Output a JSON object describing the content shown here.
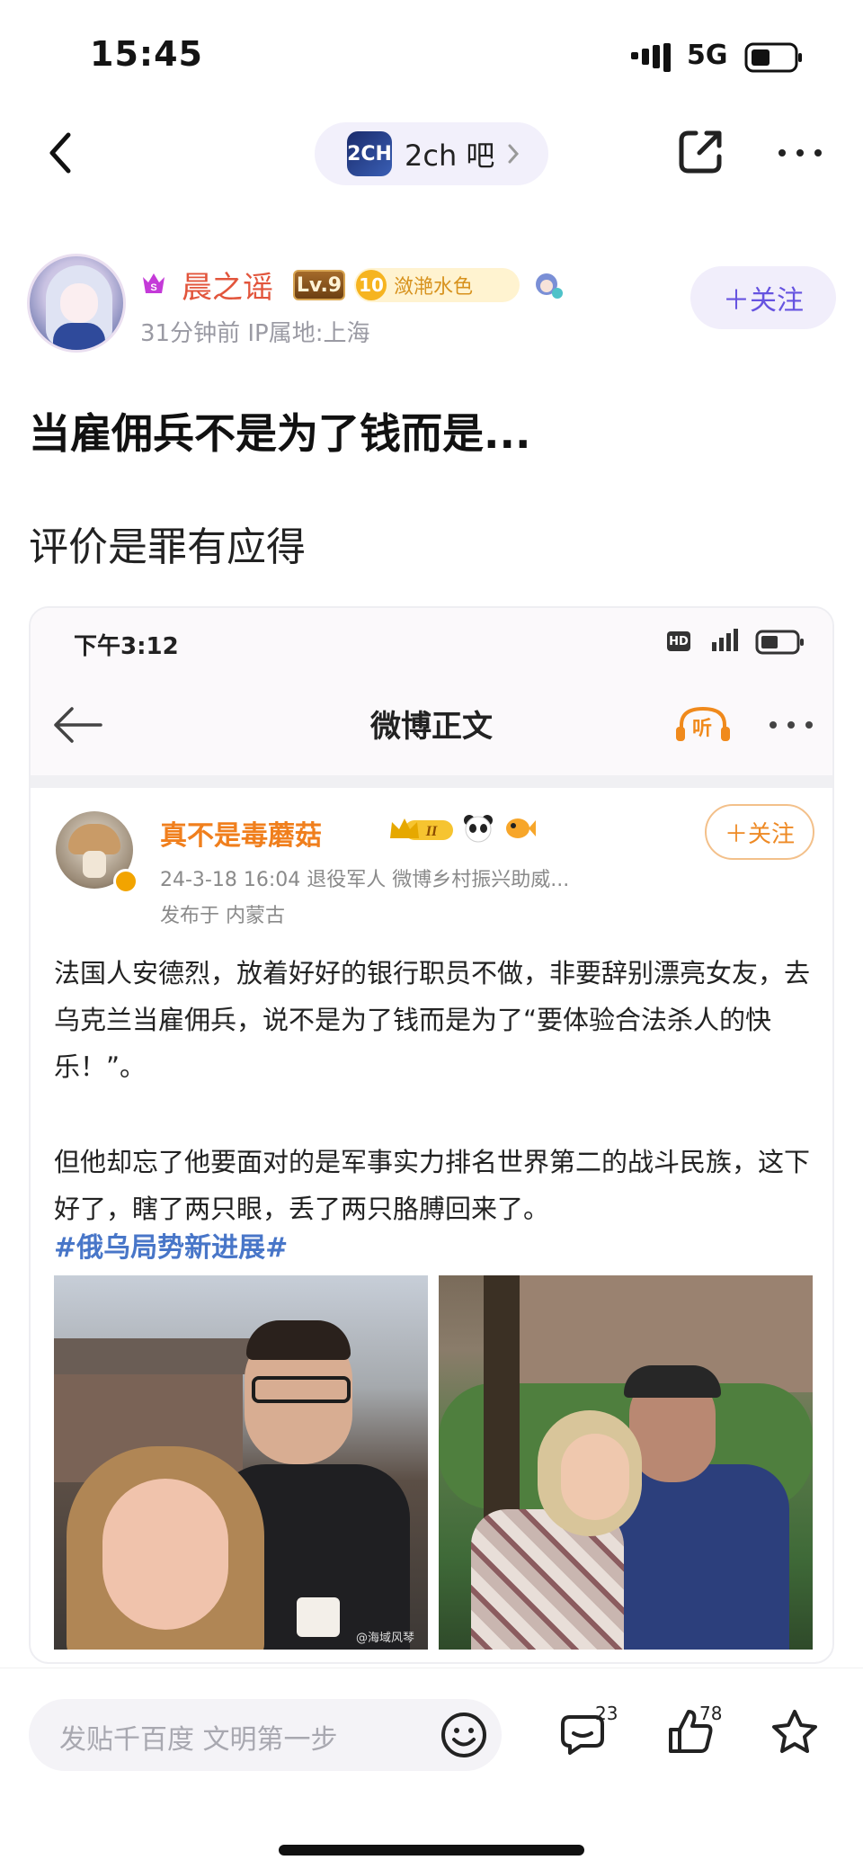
{
  "status_bar": {
    "time": "15:45",
    "network": "5G"
  },
  "nav": {
    "forum_logo_text": "2CH",
    "forum_name": "2ch 吧"
  },
  "author": {
    "name": "晨之谣",
    "level": "Lv.9",
    "title_number": "10",
    "title_text": "潋滟水色",
    "meta": "31分钟前   IP属地:上海",
    "follow_label": "＋关注"
  },
  "post": {
    "title": "当雇佣兵不是为了钱而是...",
    "body": "评价是罪有应得"
  },
  "embed": {
    "status_time": "下午3:12",
    "hd_label": "HD",
    "nav_title": "微博正文",
    "listen_label": "听",
    "user_name": "真不是毒蘑菇",
    "follow_label": "＋关注",
    "meta_line1": "24-3-18 16:04   退役军人   微博乡村振兴助威...",
    "meta_line2": "发布于 内蒙古",
    "paragraph1": "法国人安德烈，放着好好的银行职员不做，非要辞别漂亮女友，去乌克兰当雇佣兵，说不是为了钱而是为了“要体验合法杀人的快乐！”。",
    "paragraph2": "但他却忘了他要面对的是军事实力排名世界第二的战斗民族，这下好了，瞎了两只眼，丢了两只胳膊回来了。",
    "hashtag": "#俄乌局势新进展#",
    "photo_watermark": "@海域风琴"
  },
  "bottom_bar": {
    "reply_placeholder": "发贴千百度 文明第一步",
    "comment_count": "23",
    "like_count": "78"
  },
  "colors": {
    "accent": "#6653e0",
    "author_name": "#e2553c",
    "weibo_orange": "#f07f1d",
    "hashtag": "#4876c8"
  },
  "icons": [
    "back-icon",
    "chevron-right-icon",
    "share-icon",
    "more-icon",
    "emoji-icon",
    "comment-icon",
    "like-icon",
    "star-icon",
    "listen-icon",
    "signal-icon",
    "battery-icon"
  ]
}
